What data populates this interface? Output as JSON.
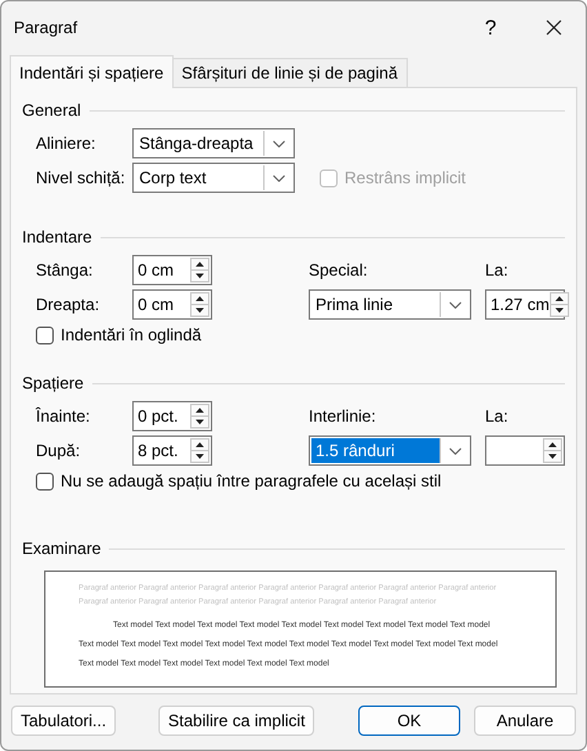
{
  "window": {
    "title": "Paragraf",
    "help_button": "?"
  },
  "tabs": [
    {
      "label": "Indentări și spațiere",
      "selected": true
    },
    {
      "label": "Sfârșituri de linie și de pagină",
      "selected": false
    }
  ],
  "general": {
    "title": "General",
    "alignment": {
      "label": "Aliniere:",
      "value": "Stânga-dreapta"
    },
    "outline_level": {
      "label": "Nivel schiță:",
      "value": "Corp text"
    },
    "collapsed": {
      "label": "Restrâns implicit",
      "checked": false,
      "disabled": true
    }
  },
  "indentation": {
    "title": "Indentare",
    "left": {
      "label": "Stânga:",
      "value": "0 cm"
    },
    "right": {
      "label": "Dreapta:",
      "value": "0 cm"
    },
    "special": {
      "label": "Special:",
      "value": "Prima linie",
      "focused": false
    },
    "by": {
      "label": "La:",
      "value": "1.27 cm"
    },
    "mirror": {
      "label": "Indentări în oglindă",
      "checked": false,
      "disabled": false
    }
  },
  "spacing": {
    "title": "Spațiere",
    "before": {
      "label": "Înainte:",
      "value": "0 pct."
    },
    "after": {
      "label": "După:",
      "value": "8 pct."
    },
    "line_spacing": {
      "label": "Interlinie:",
      "value": "1.5 rânduri",
      "focused": true
    },
    "at": {
      "label": "La:"
    },
    "no_space": {
      "label": "Nu se adaugă spațiu între paragrafele cu același stil",
      "checked": false,
      "disabled": false
    }
  },
  "preview": {
    "title": "Examinare",
    "previous_paragraph": "Paragraf anterior Paragraf anterior Paragraf anterior Paragraf anterior Paragraf anterior Paragraf anterior Paragraf anterior Paragraf anterior Paragraf anterior Paragraf anterior Paragraf anterior Paragraf anterior Paragraf anterior",
    "sample_text": "Text model Text model Text model Text model Text model Text model Text model Text model Text model Text model Text model Text model Text model Text model Text model Text model Text model Text model Text model Text model Text model Text model Text model Text model Text model"
  },
  "buttons": [
    {
      "label": "Tabulatori...",
      "default": false
    },
    {
      "label": "Stabilire ca implicit",
      "default": false
    },
    {
      "label": "OK",
      "default": true
    },
    {
      "label": "Anulare",
      "default": false
    }
  ]
}
